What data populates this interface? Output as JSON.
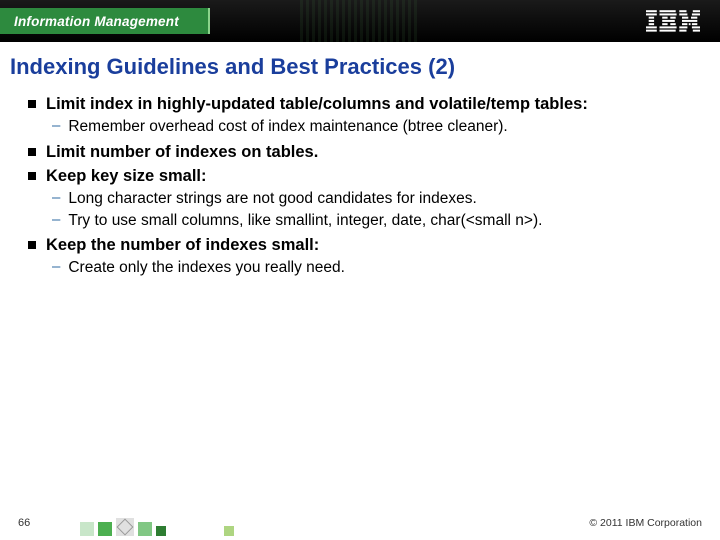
{
  "header": {
    "brand": "Information Management",
    "logo_label": "IBM"
  },
  "title": "Indexing Guidelines and Best Practices (2)",
  "bullets": [
    {
      "text": "Limit index in highly-updated table/columns and volatile/temp tables:",
      "sub": [
        "Remember overhead cost of index maintenance (btree cleaner)."
      ]
    },
    {
      "text": "Limit number of indexes on tables.",
      "sub": []
    },
    {
      "text": "Keep key size small:",
      "sub": [
        "Long character strings are not good candidates for indexes.",
        "Try to use small columns, like smallint, integer, date, char(<small n>)."
      ]
    },
    {
      "text": "Keep the number of indexes small:",
      "sub": [
        "Create only the indexes you really need."
      ]
    }
  ],
  "footer": {
    "page": "66",
    "copyright": "© 2011 IBM Corporation"
  }
}
